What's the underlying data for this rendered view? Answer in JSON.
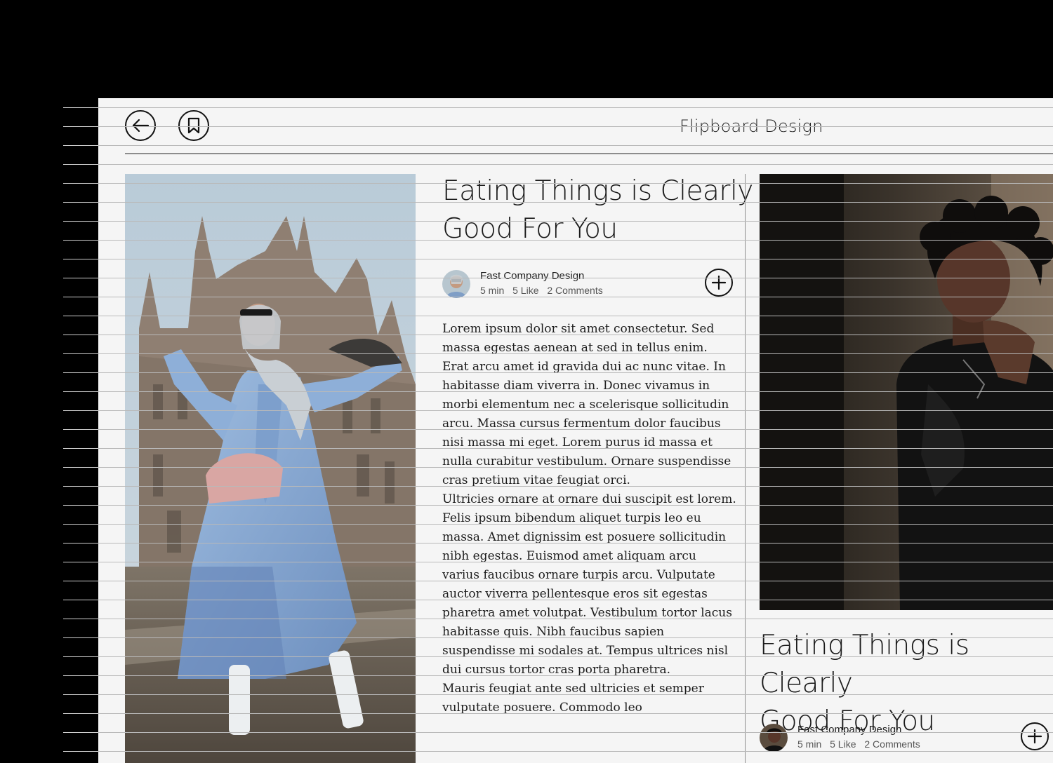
{
  "header": {
    "title": "Flipboard Design",
    "back_icon": "arrow-left-icon",
    "bookmark_icon": "bookmark-icon"
  },
  "articles": [
    {
      "title_line1": "Eating Things is Clearly",
      "title_line2": "Good For You",
      "source": "Fast Company Design",
      "read_time": "5 min",
      "likes": "5 Like",
      "comments": "2 Comments",
      "paragraphs": [
        "Lorem ipsum dolor sit amet consectetur. Sed massa egestas aenean at sed in tellus enim. Erat arcu amet id gravida dui ac nunc vitae. In habitasse diam viverra in. Donec vivamus in morbi elementum nec a scelerisque sollicitudin arcu. Massa cursus fermentum dolor faucibus nisi massa mi eget. Lorem purus id massa et nulla curabitur vestibulum. Ornare suspendisse cras pretium vitae feugiat orci.",
        "Ultricies ornare at ornare dui suscipit est lorem. Felis ipsum bibendum aliquet turpis leo eu massa. Amet dignissim est posuere sollicitudin nibh egestas. Euismod amet aliquam arcu varius faucibus ornare turpis arcu. Vulputate auctor viverra pellentesque eros sit egestas pharetra amet volutpat. Vestibulum tortor lacus habitasse quis. Nibh faucibus sapien suspendisse mi sodales at. Tempus ultrices nisl dui cursus tortor cras porta pharetra.",
        "Mauris feugiat ante sed ultricies et semper vulputate posuere. Commodo leo"
      ]
    },
    {
      "title_line1": "Eating Things is Clearly",
      "title_line2": "Good For You",
      "source": "Fast Company Design",
      "read_time": "5 min",
      "likes": "5 Like",
      "comments": "2 Comments"
    }
  ],
  "icons": {
    "follow": "plus-circle-icon"
  },
  "colors": {
    "page_background": "#f5f5f5",
    "outer_background": "#000000",
    "text": "#1a1a1a",
    "rule": "#8d8d8d"
  }
}
